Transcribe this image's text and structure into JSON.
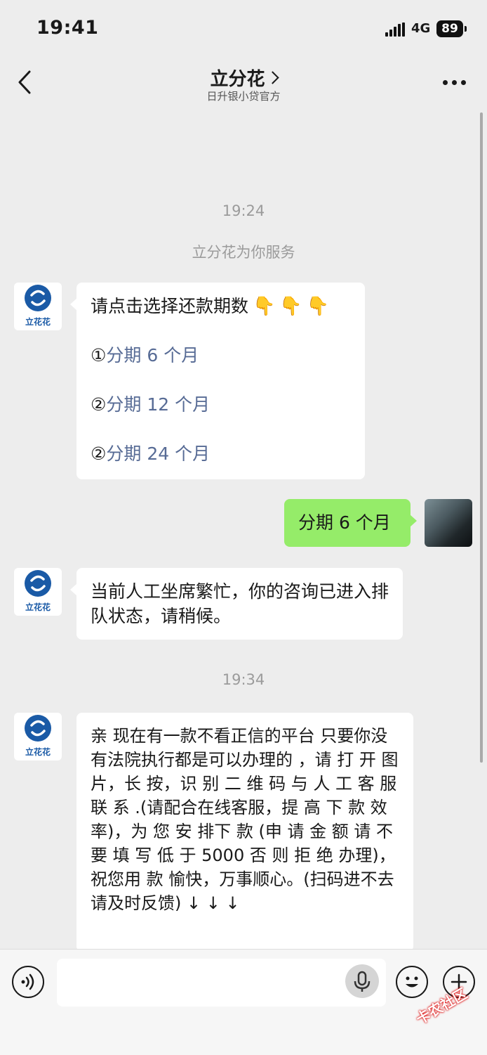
{
  "status_bar": {
    "time": "19:41",
    "network": "4G",
    "battery": "89"
  },
  "nav": {
    "title": "立分花",
    "subtitle": "日升银小贷官方"
  },
  "chat": {
    "timestamp_1": "19:24",
    "system_message": "立分花为你服务",
    "bot_brand": "立花花",
    "msg_options": {
      "prompt": "请点击选择还款期数",
      "emoji": "👇",
      "options": [
        {
          "num": "①",
          "label": "分期 6 个月"
        },
        {
          "num": "②",
          "label": "分期 12 个月"
        },
        {
          "num": "②",
          "label": "分期 24 个月"
        }
      ]
    },
    "msg_user": "分期 6 个月",
    "msg_queue": "当前人工坐席繁忙，你的咨询已进入排队状态，请稍候。",
    "timestamp_2": "19:34",
    "msg_ad": "亲 现在有一款不看正信的平台 只要你没有法院执行都是可以办理的 ，请 打 开 图片，长 按，识 别 二 维 码 与 人 工 客 服 联 系 .(请配合在线客服，提 高 下 款 效 率)，为 您 安 排下 款 (申 请 金 额 请 不 要 填 写 低 于 5000 否 则 拒 绝 办理)，祝您用 款 愉快，万事顺心。(扫码进不去请及时反馈) ↓ ↓ ↓"
  },
  "input_bar": {
    "placeholder": ""
  },
  "watermark": "卡农社区",
  "colors": {
    "background": "#ededed",
    "bubble_self": "#95ec69",
    "link": "#576b95",
    "brand": "#1a5aa6"
  }
}
